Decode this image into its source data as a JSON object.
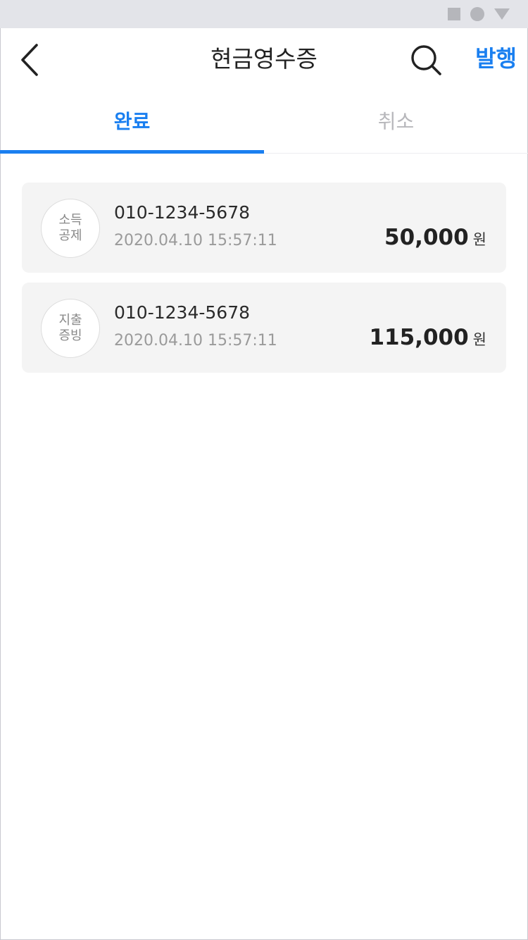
{
  "header": {
    "title": "현금영수증",
    "back_icon": "chevron-left-icon",
    "search_icon": "search-icon",
    "issue_label": "발행"
  },
  "tabs": [
    {
      "label": "완료",
      "active": true
    },
    {
      "label": "취소",
      "active": false
    }
  ],
  "receipts": [
    {
      "badge_line1": "소득",
      "badge_line2": "공제",
      "phone": "010-1234-5678",
      "datetime": "2020.04.10 15:57:11",
      "amount": "50,000",
      "unit": "원"
    },
    {
      "badge_line1": "지출",
      "badge_line2": "증빙",
      "phone": "010-1234-5678",
      "datetime": "2020.04.10 15:57:11",
      "amount": "115,000",
      "unit": "원"
    }
  ],
  "colors": {
    "accent": "#1a7ff0",
    "card_bg": "#f4f4f4",
    "status_bar_bg": "#e3e4e9"
  }
}
